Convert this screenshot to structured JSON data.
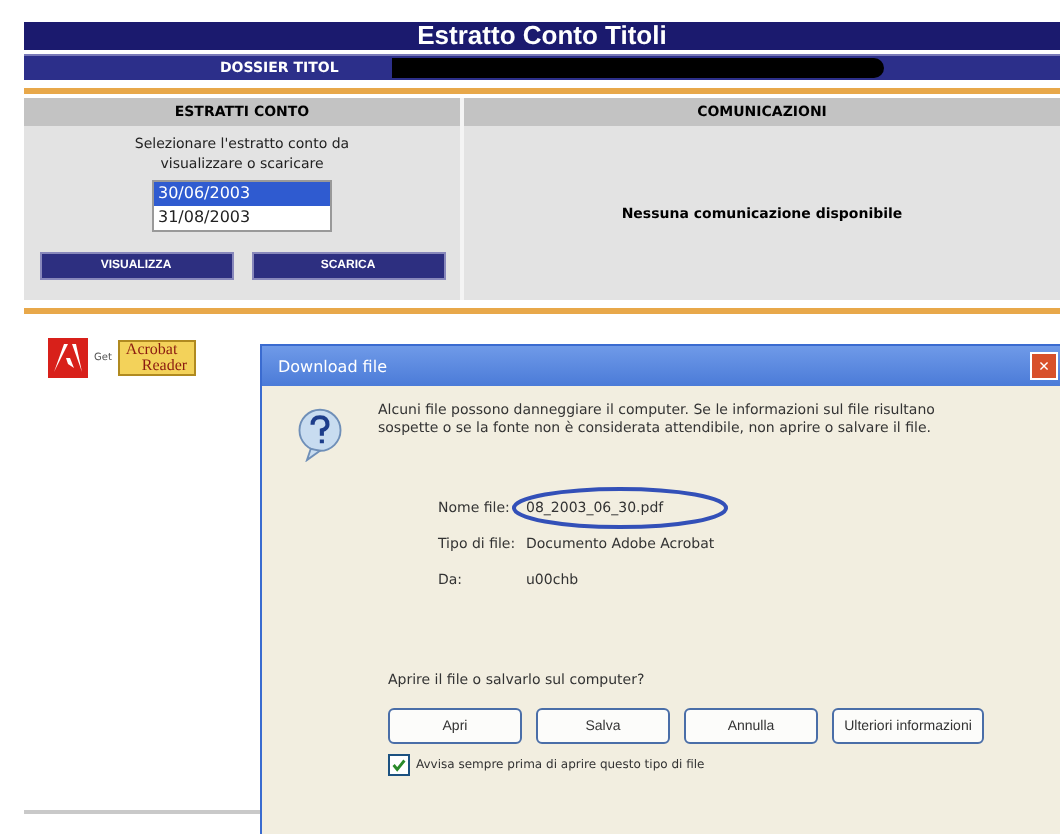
{
  "page": {
    "title": "Estratto Conto Titoli",
    "dossier_label": "DOSSIER TITOL",
    "statements": {
      "heading": "ESTRATTI CONTO",
      "instructions": "Selezionare l'estratto conto da visualizzare o scaricare",
      "dates": [
        {
          "label": "30/06/2003",
          "selected": true
        },
        {
          "label": "31/08/2003",
          "selected": false
        }
      ],
      "buttons": [
        "VISUALIZZA",
        "SCARICA"
      ]
    },
    "messages": {
      "heading": "COMUNICAZIONI",
      "text": "Nessuna comunicazione disponibile"
    },
    "acrobat_badge": {
      "get": "Get",
      "line1": "Acrobat",
      "line2": "Reader"
    }
  },
  "dialog": {
    "title": "Download file",
    "close": "×",
    "warning": "Alcuni file possono danneggiare il computer. Se le informazioni sul file risultano sospette o se la fonte non è considerata attendibile, non aprire o salvare il file.",
    "fields": [
      {
        "label": "Nome file:",
        "value": "08_2003_06_30.pdf"
      },
      {
        "label": "Tipo di file:",
        "value": "Documento Adobe Acrobat"
      },
      {
        "label": "Da:",
        "value": "u00chb"
      }
    ],
    "question": "Aprire il file o salvarlo sul computer?",
    "buttons": [
      "Apri",
      "Salva",
      "Annulla",
      "Ulteriori informazioni"
    ],
    "always_ask": {
      "label": "Avvisa sempre prima di aprire questo tipo di file",
      "checked": true
    }
  }
}
